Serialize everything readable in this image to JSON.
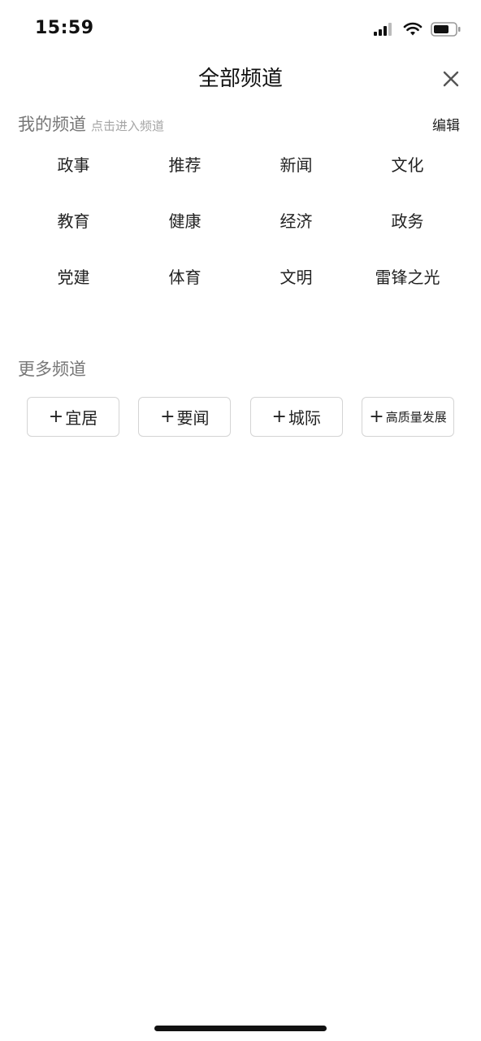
{
  "status_bar": {
    "time": "15:59",
    "icons": [
      "cellular-signal-icon",
      "wifi-icon",
      "battery-icon"
    ]
  },
  "header": {
    "title": "全部频道",
    "close_icon": "close-icon"
  },
  "my_channels": {
    "title": "我的频道",
    "hint": "点击进入频道",
    "edit_label": "编辑",
    "items": [
      "政事",
      "推荐",
      "新闻",
      "文化",
      "教育",
      "健康",
      "经济",
      "政务",
      "党建",
      "体育",
      "文明",
      "雷锋之光"
    ]
  },
  "more_channels": {
    "title": "更多频道",
    "plus_symbol": "+",
    "items": [
      "宜居",
      "要闻",
      "城际",
      "高质量发展"
    ]
  },
  "colors": {
    "background": "#ffffff",
    "section_title": "#777777",
    "hint": "#a5a5a5",
    "text": "#222222",
    "border": "#d4d4d4"
  }
}
